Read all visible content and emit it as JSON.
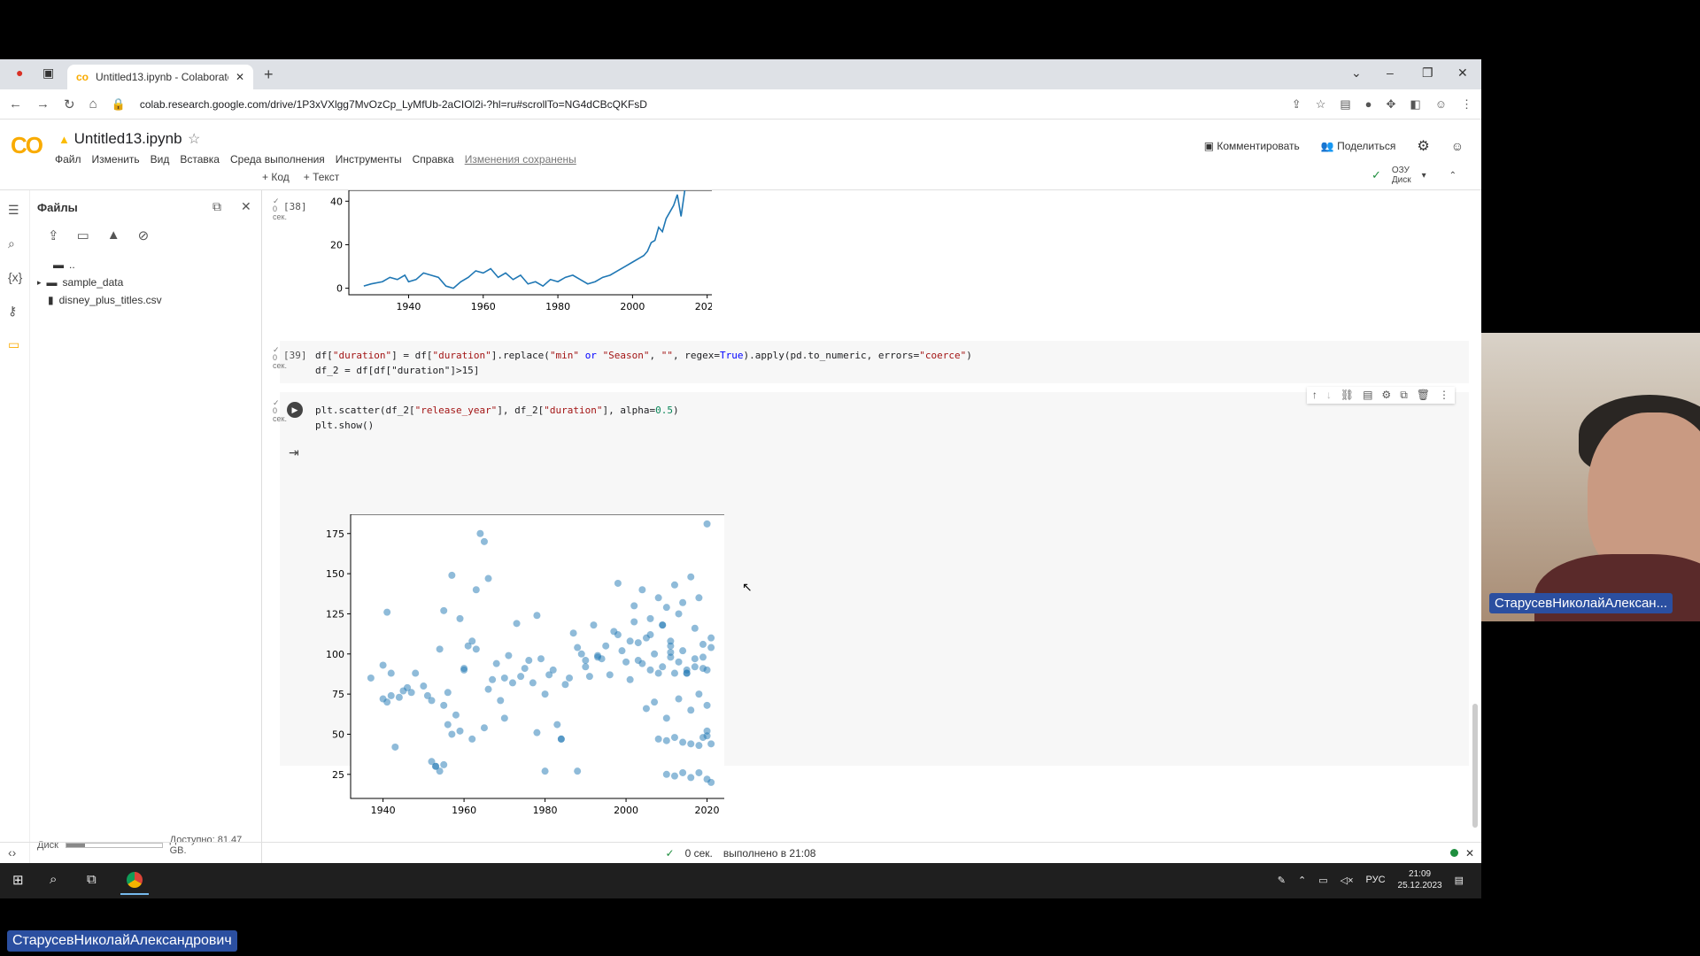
{
  "browser": {
    "tab_title": "Untitled13.ipynb - Colaboratory",
    "url": "colab.research.google.com/drive/1P3xVXlgg7MvOzCp_LyMfUb-2aCIOl2i-?hl=ru#scrollTo=NG4dCBcQKFsD"
  },
  "colab": {
    "logo": "CO",
    "notebook_title": "Untitled13.ipynb",
    "menu": [
      "Файл",
      "Изменить",
      "Вид",
      "Вставка",
      "Среда выполнения",
      "Инструменты",
      "Справка"
    ],
    "saved_status": "Изменения сохранены",
    "comment_label": "Комментировать",
    "share_label": "Поделиться",
    "add_code": "+ Код",
    "add_text": "+ Текст",
    "ram_label": "ОЗУ",
    "disk_label": "Диск"
  },
  "files": {
    "title": "Файлы",
    "parent": "..",
    "items": [
      "sample_data",
      "disney_plus_titles.csv"
    ],
    "disk_label": "Диск",
    "available": "Доступно: 81.47 GB.",
    "disk_used_fraction": 0.2
  },
  "cells": {
    "cell38": {
      "count": "[38]",
      "status": "✓\n0\nсек."
    },
    "cell39": {
      "count": "[39]",
      "status": "✓\n0\nсек.",
      "line1": "df[\"duration\"] = df[\"duration\"].replace(\"min\" or \"Season\", \"\", regex=True).apply(pd.to_numeric, errors=\"coerce\")",
      "line2": "df_2 = df[df[\"duration\"]>15]"
    },
    "cell40": {
      "status": "✓\n0\nсек.",
      "line1": "plt.scatter(df_2[\"release_year\"], df_2[\"duration\"], alpha=0.5)",
      "line2": "plt.show()"
    }
  },
  "chart_data": [
    {
      "type": "line",
      "title": "",
      "xlabel": "",
      "ylabel": "",
      "xlim": [
        1924,
        2026
      ],
      "ylim": [
        -3,
        45
      ],
      "x_ticks": [
        1940,
        1960,
        1980,
        2000,
        2020
      ],
      "y_ticks": [
        0,
        20,
        40
      ],
      "color": "#1f77b4",
      "x": [
        1928,
        1930,
        1933,
        1935,
        1937,
        1939,
        1940,
        1942,
        1944,
        1946,
        1948,
        1950,
        1952,
        1954,
        1956,
        1958,
        1960,
        1962,
        1964,
        1966,
        1968,
        1970,
        1972,
        1974,
        1976,
        1978,
        1980,
        1982,
        1984,
        1986,
        1988,
        1990,
        1992,
        1994,
        1996,
        1998,
        2000,
        2002,
        2003,
        2004,
        2005,
        2006,
        2007,
        2008,
        2009,
        2010,
        2011,
        2012,
        2013,
        2014
      ],
      "y": [
        1,
        2,
        3,
        5,
        4,
        6,
        3,
        4,
        7,
        6,
        5,
        1,
        0,
        3,
        5,
        8,
        7,
        9,
        5,
        7,
        4,
        6,
        2,
        3,
        1,
        4,
        3,
        5,
        6,
        4,
        2,
        3,
        5,
        6,
        8,
        10,
        12,
        14,
        15,
        17,
        21,
        22,
        28,
        26,
        32,
        35,
        38,
        43,
        33,
        45
      ]
    },
    {
      "type": "scatter",
      "title": "",
      "xlabel": "",
      "ylabel": "",
      "xlim": [
        1932,
        2026
      ],
      "ylim": [
        10,
        187
      ],
      "x_ticks": [
        1940,
        1960,
        1980,
        2000,
        2020
      ],
      "y_ticks": [
        25,
        50,
        75,
        100,
        125,
        150,
        175
      ],
      "color": "#1f77b4",
      "alpha": 0.5,
      "x": [
        1937,
        1940,
        1941,
        1941,
        1942,
        1943,
        1944,
        1945,
        1946,
        1947,
        1948,
        1950,
        1951,
        1952,
        1953,
        1954,
        1955,
        1955,
        1956,
        1957,
        1958,
        1959,
        1960,
        1961,
        1962,
        1963,
        1964,
        1965,
        1966,
        1967,
        1968,
        1969,
        1970,
        1971,
        1972,
        1973,
        1974,
        1975,
        1976,
        1977,
        1978,
        1979,
        1980,
        1981,
        1982,
        1983,
        1984,
        1985,
        1986,
        1987,
        1988,
        1989,
        1990,
        1991,
        1992,
        1993,
        1994,
        1995,
        1996,
        1997,
        1998,
        1999,
        2000,
        2001,
        2002,
        2003,
        2004,
        2005,
        2006,
        2007,
        2008,
        2009,
        2010,
        2011,
        2012,
        2013,
        2014,
        2015,
        2016,
        2017,
        2018,
        2019,
        2020,
        2021,
        1952,
        1953,
        1954,
        1955,
        1956,
        1957,
        1959,
        1962,
        1965,
        1978,
        1980,
        1984,
        1988,
        1940,
        1942,
        1960,
        1963,
        2008,
        2010,
        2012,
        2014,
        2016,
        2018,
        2020,
        2021,
        2010,
        2012,
        2014,
        2016,
        2018,
        2020,
        2021,
        2019,
        2020,
        2006,
        2009,
        2011,
        2013,
        2015,
        2017,
        2019,
        2005,
        2007,
        2010,
        2013,
        2016,
        2018,
        2020,
        1966,
        1970,
        1990,
        1993,
        1998,
        2002,
        2004,
        2011,
        2015,
        2020,
        2001,
        2003,
        2006,
        2009,
        2012,
        2014,
        2017,
        2019,
        2021,
        2008,
        2011
      ],
      "y": [
        85,
        72,
        126,
        70,
        74,
        42,
        73,
        77,
        79,
        76,
        88,
        80,
        74,
        71,
        30,
        103,
        127,
        68,
        76,
        149,
        62,
        122,
        90,
        105,
        108,
        140,
        175,
        170,
        147,
        84,
        94,
        71,
        60,
        99,
        82,
        119,
        86,
        91,
        96,
        82,
        124,
        97,
        75,
        87,
        90,
        56,
        47,
        81,
        85,
        113,
        104,
        100,
        96,
        86,
        118,
        98,
        97,
        105,
        87,
        114,
        144,
        102,
        95,
        108,
        130,
        107,
        140,
        110,
        122,
        100,
        135,
        118,
        129,
        108,
        143,
        125,
        132,
        90,
        148,
        116,
        135,
        91,
        181,
        110,
        33,
        30,
        27,
        31,
        56,
        50,
        52,
        47,
        54,
        51,
        27,
        47,
        27,
        93,
        88,
        91,
        103,
        47,
        46,
        48,
        45,
        44,
        43,
        49,
        44,
        25,
        24,
        26,
        23,
        26,
        22,
        20,
        48,
        52,
        112,
        118,
        105,
        95,
        88,
        92,
        98,
        66,
        70,
        60,
        72,
        65,
        75,
        68,
        78,
        85,
        92,
        99,
        112,
        120,
        94,
        101,
        88,
        90,
        84,
        96,
        90,
        92,
        88,
        102,
        97,
        106,
        104,
        88,
        98
      ]
    }
  ],
  "statusbar": {
    "duration": "0 сек.",
    "completed": "выполнено в 21:08"
  },
  "taskbar": {
    "lang": "РУС",
    "time": "21:09",
    "date": "25.12.2023"
  },
  "participant": {
    "short_name": "СтарусевНиколайАлексан...",
    "full_name": "СтарусевНиколайАлександрович"
  }
}
